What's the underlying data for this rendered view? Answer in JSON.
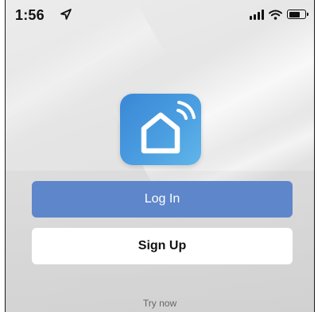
{
  "status_bar": {
    "time": "1:56",
    "icons": [
      "location-arrow-icon",
      "signal-bars-icon",
      "wifi-icon",
      "battery-icon"
    ]
  },
  "app": {
    "logo_icon": "smart-home-icon",
    "accent_color": "#5e86cb",
    "logo_gradient": [
      "#3a87d6",
      "#62b6ea"
    ]
  },
  "actions": {
    "login_label": "Log In",
    "signup_label": "Sign Up",
    "try_now_label": "Try now"
  }
}
